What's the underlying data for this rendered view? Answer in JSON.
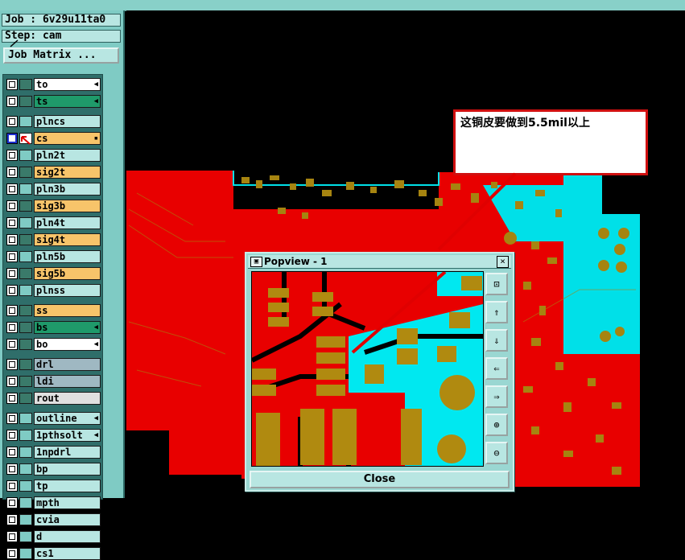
{
  "job": {
    "label": "Job : 6v29u11ta0",
    "step": "Step: cam",
    "matrix_button": "Job Matrix ..."
  },
  "layers": [
    {
      "name": "to",
      "color": "#ffffff",
      "mark": "◀",
      "active": false
    },
    {
      "name": "ts",
      "color": "#1f9a6a",
      "mark": "◀",
      "active": false
    },
    {
      "name": "plncs",
      "color": "#b8e6e2",
      "mark": "",
      "active": false
    },
    {
      "name": "cs",
      "color": "#f7c46a",
      "mark": "▪",
      "active": true
    },
    {
      "name": "pln2t",
      "color": "#b8e6e2",
      "mark": "",
      "active": false
    },
    {
      "name": "sig2t",
      "color": "#f7c46a",
      "mark": "",
      "active": false
    },
    {
      "name": "pln3b",
      "color": "#b8e6e2",
      "mark": "",
      "active": false
    },
    {
      "name": "sig3b",
      "color": "#f7c46a",
      "mark": "",
      "active": false
    },
    {
      "name": "pln4t",
      "color": "#b8e6e2",
      "mark": "",
      "active": false
    },
    {
      "name": "sig4t",
      "color": "#f7c46a",
      "mark": "",
      "active": false
    },
    {
      "name": "pln5b",
      "color": "#b8e6e2",
      "mark": "",
      "active": false
    },
    {
      "name": "sig5b",
      "color": "#f7c46a",
      "mark": "",
      "active": false
    },
    {
      "name": "plnss",
      "color": "#b8e6e2",
      "mark": "",
      "active": false
    },
    {
      "name": "ss",
      "color": "#f7c46a",
      "mark": "",
      "active": false
    },
    {
      "name": "bs",
      "color": "#1f9a6a",
      "mark": "◀",
      "active": false
    },
    {
      "name": "bo",
      "color": "#ffffff",
      "mark": "◀",
      "active": false
    },
    {
      "name": "drl",
      "color": "#9fb8c2",
      "mark": "",
      "active": false
    },
    {
      "name": "ldi",
      "color": "#9fb8c2",
      "mark": "",
      "active": false
    },
    {
      "name": "rout",
      "color": "#e0e0e0",
      "mark": "",
      "active": false
    },
    {
      "name": "outline",
      "color": "#b8e6e2",
      "mark": "◀",
      "active": false
    },
    {
      "name": "1pthsolt",
      "color": "#b8e6e2",
      "mark": "◀",
      "active": false
    },
    {
      "name": "1npdrl",
      "color": "#b8e6e2",
      "mark": "",
      "active": false
    },
    {
      "name": "bp",
      "color": "#b8e6e2",
      "mark": "",
      "active": false
    },
    {
      "name": "tp",
      "color": "#b8e6e2",
      "mark": "",
      "active": false
    },
    {
      "name": "mpth",
      "color": "#b8e6e2",
      "mark": "",
      "active": false
    },
    {
      "name": "cvia",
      "color": "#b8e6e2",
      "mark": "",
      "active": false
    },
    {
      "name": "d",
      "color": "#b8e6e2",
      "mark": "",
      "active": false
    },
    {
      "name": "cs1",
      "color": "#b8e6e2",
      "mark": "",
      "active": false
    }
  ],
  "popup": {
    "title": "Popview - 1",
    "close_label": "Close",
    "close_x": "×",
    "tool_icons": [
      "zoom-fit-icon",
      "pan-up-icon",
      "pan-down-icon",
      "pan-left-icon",
      "pan-right-icon",
      "zoom-in-icon",
      "zoom-out-icon"
    ],
    "tool_glyphs": [
      "⊡",
      "⇑",
      "⇓",
      "⇐",
      "⇒",
      "⊕",
      "⊖"
    ]
  },
  "annotation": {
    "text": "这铜皮要做到5.5mil以上"
  },
  "colors": {
    "copper": "#ff1010",
    "pad": "#b08a10",
    "board_edge": "#00e8f0",
    "background": "#000000",
    "panel": "#7fcbc4"
  }
}
